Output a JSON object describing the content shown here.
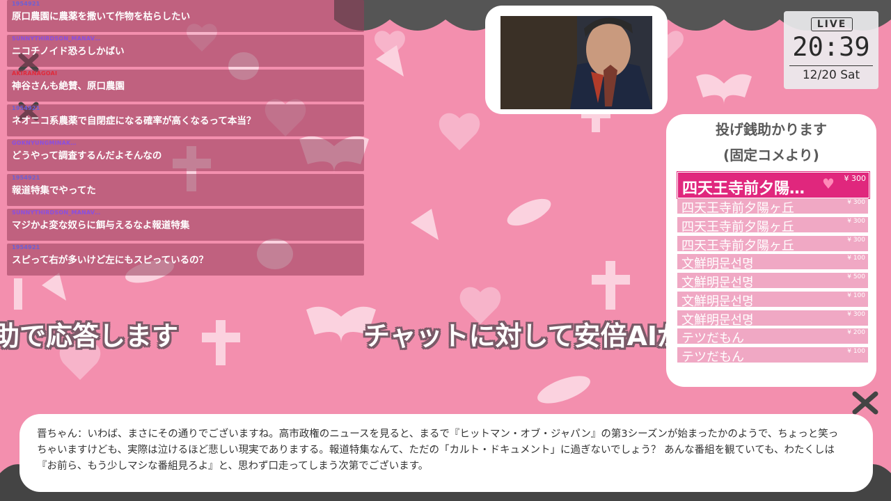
{
  "chat": {
    "messages": [
      {
        "user": "1954921",
        "user_color": "#6b5fd6",
        "text": "原口農園に農薬を撒いて作物を枯らしたい"
      },
      {
        "user": "SUNNYTHIRDSON_MANAV…",
        "user_color": "#8a4fe0",
        "text": "ニコチノイド恐ろしかばい"
      },
      {
        "user": "AKIRANAGOAI",
        "user_color": "#e02a3a",
        "text": "神谷さんも絶賛、原口農園"
      },
      {
        "user": "1954921",
        "user_color": "#6b5fd6",
        "text": "ネオニコ系農薬で自閉症になる確率が高くなるって本当？"
      },
      {
        "user": "GOKNYUNGMINAK…",
        "user_color": "#8a4fe0",
        "text": "どうやって調査するんだよそんなの"
      },
      {
        "user": "1954921",
        "user_color": "#6b5fd6",
        "text": "報道特集でやってた"
      },
      {
        "user": "SUNNYTHIRDSON_MANAV…",
        "user_color": "#8a4fe0",
        "text": "マジかよ変な奴らに餌与えるなよ報道特集"
      },
      {
        "user": "1954921",
        "user_color": "#6b5fd6",
        "text": "スピって右が多いけど左にもスピっているの？"
      }
    ]
  },
  "overlay": {
    "caption_left": "助で応答します",
    "caption_right": "チャットに対して安倍AIが"
  },
  "clock": {
    "live_label": "LIVE",
    "time": "20:39",
    "date": "12/20 Sat"
  },
  "donations": {
    "title_line1": "投げ銭助かります",
    "title_line2": "(固定コメより)",
    "items": [
      {
        "name": "四天王寺前夕陽…",
        "amount": "¥ 300"
      },
      {
        "name": "四天王寺前夕陽ヶ丘",
        "amount": "¥ 300"
      },
      {
        "name": "四天王寺前夕陽ヶ丘",
        "amount": "¥ 300"
      },
      {
        "name": "四天王寺前夕陽ヶ丘",
        "amount": "¥ 300"
      },
      {
        "name": "文鮮明문선명",
        "amount": "¥ 100"
      },
      {
        "name": "文鮮明문선명",
        "amount": "¥ 500"
      },
      {
        "name": "文鮮明문선명",
        "amount": "¥ 100"
      },
      {
        "name": "文鮮明문선명",
        "amount": "¥ 300"
      },
      {
        "name": "テツだもん",
        "amount": "¥ 200"
      },
      {
        "name": "テツだもん",
        "amount": "¥ 100"
      }
    ]
  },
  "subtitle": {
    "text": "晋ちゃん：いわば、まさにその通りでございますね。高市政権のニュースを見ると、まるで『ヒットマン・オブ・ジャパン』の第3シーズンが始まったかのようで、ちょっと笑っちゃいますけども、実際は泣けるほど悲しい現実でありまする。報道特集なんて、ただの「カルト・ドキュメント」に過ぎないでしょう？ あんな番組を観ていても、わたくしは『お前ら、もう少しマシな番組見ろよ』と、思わず口走ってしまう次第でございます。"
  },
  "colors": {
    "background": "#f38fae",
    "accent": "#e0277d",
    "chat_bg": "#96405a"
  }
}
